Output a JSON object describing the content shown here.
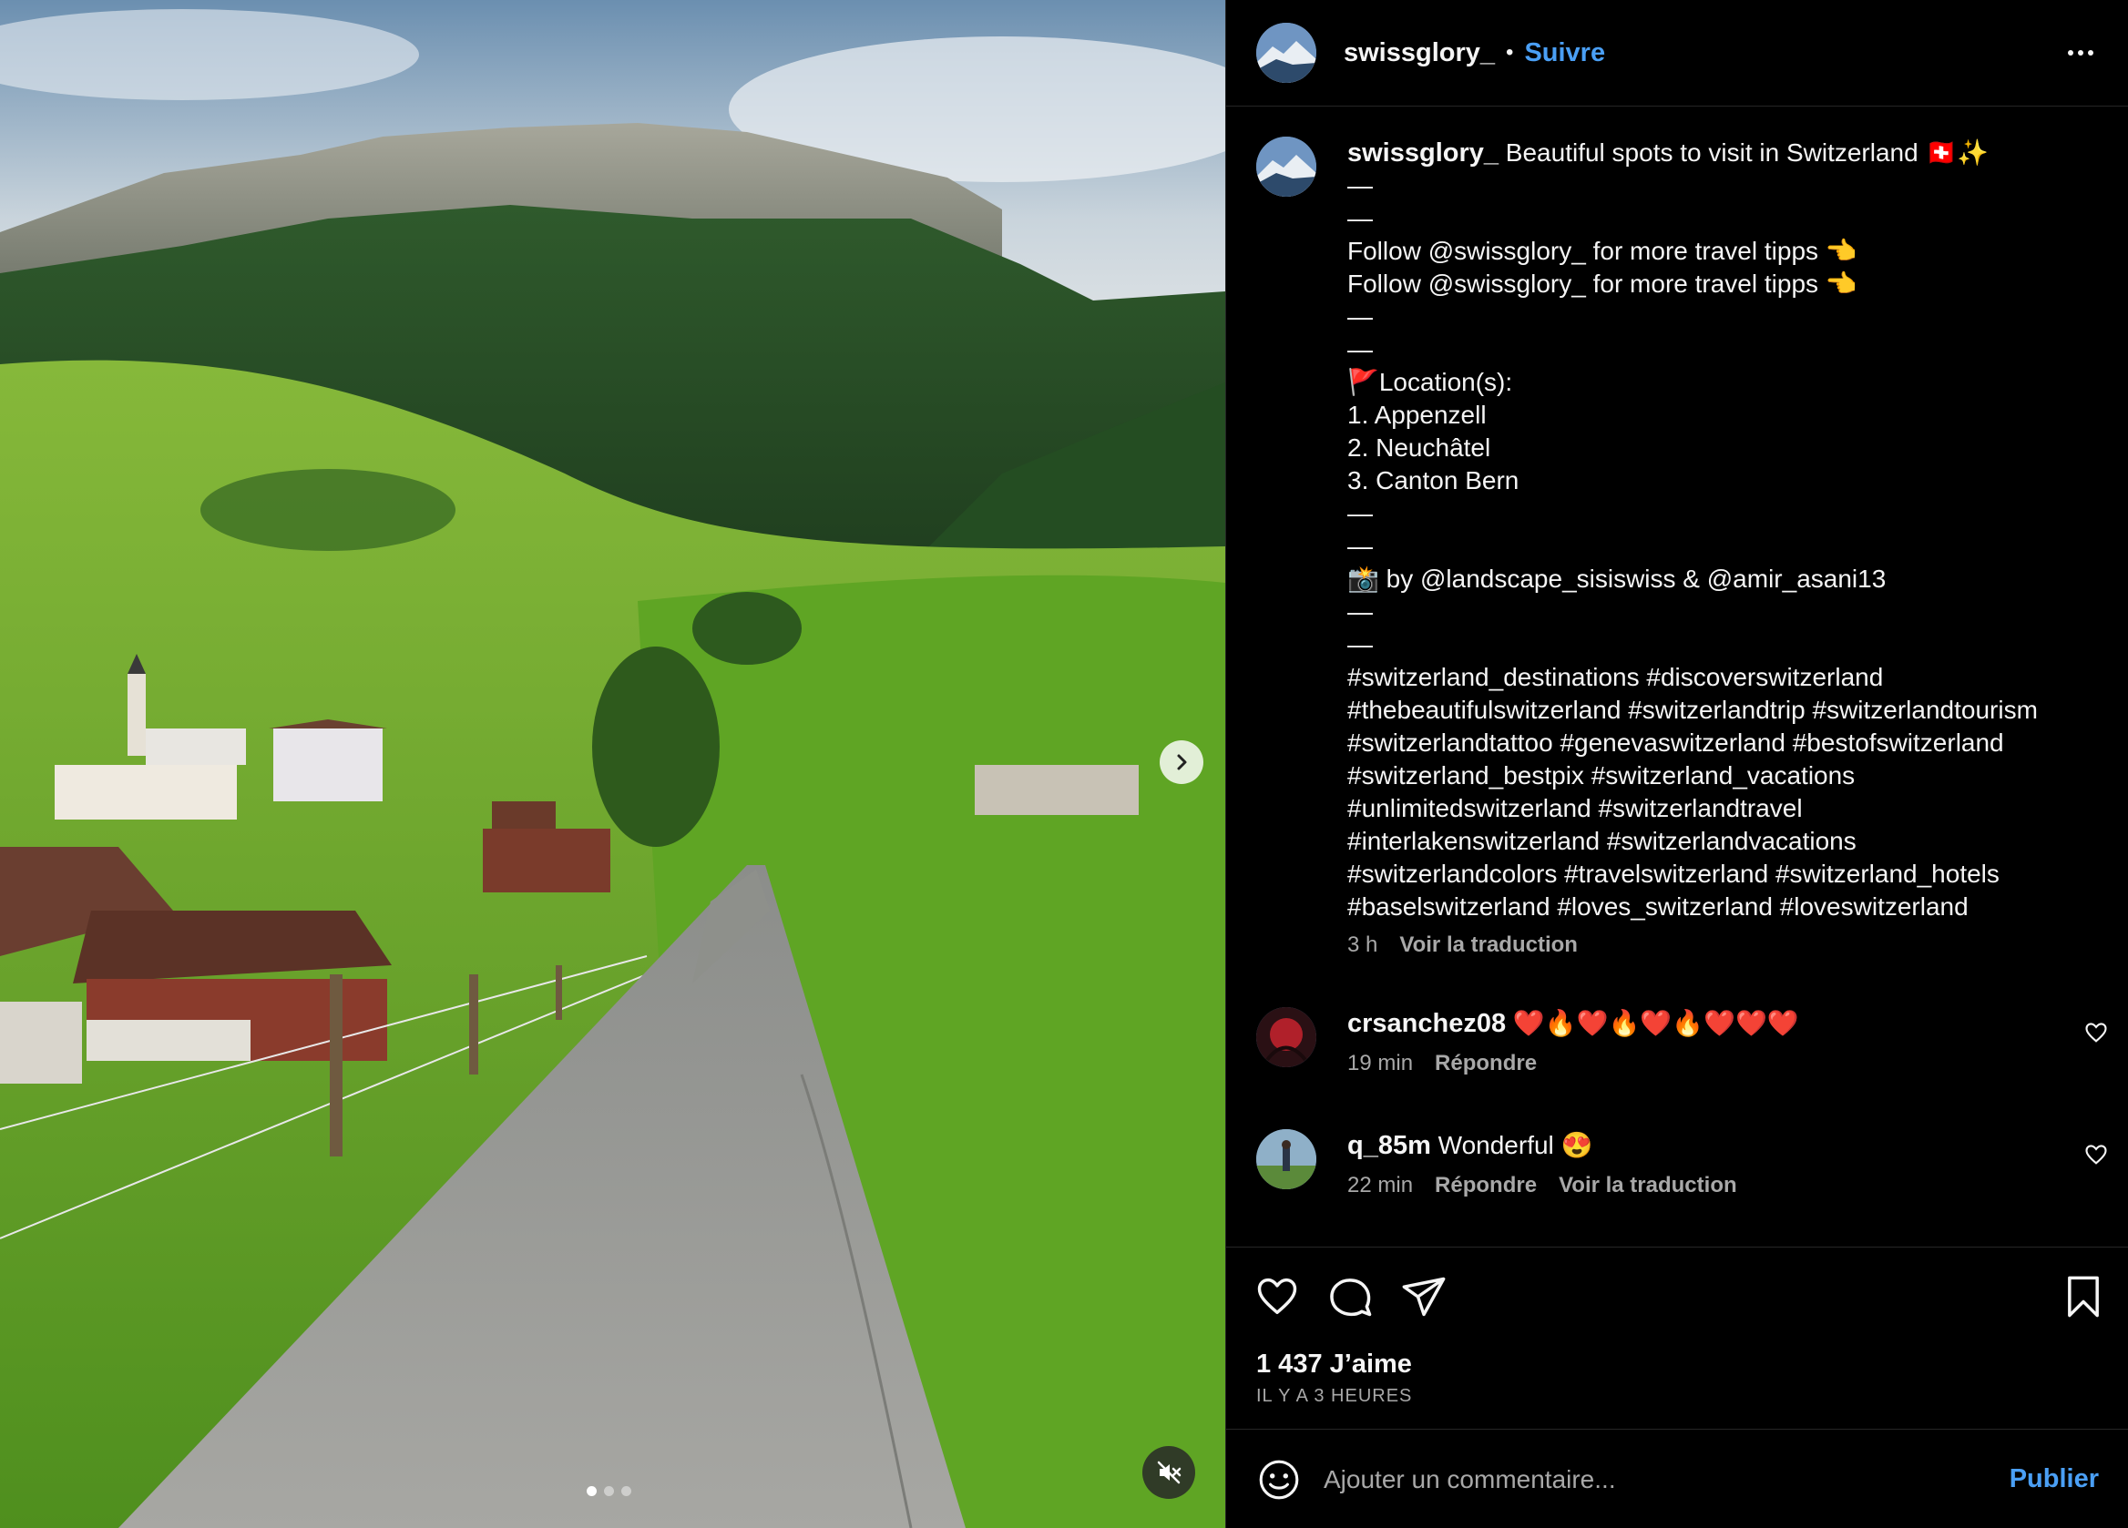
{
  "post": {
    "username": "swissglory_",
    "separator": "•",
    "follow_label": "Suivre",
    "caption_title": " Beautiful spots to visit in Switzerland 🇨🇭✨",
    "caption_body": "—\n—\nFollow @swissglory_ for more travel tipps 👈\nFollow @swissglory_ for more travel tipps 👈\n—\n—\n🚩Location(s):\n1. Appenzell\n2. Neuchâtel\n3. Canton Bern\n—\n—\n📸 by @landscape_sisiswiss & @amir_asani13\n—\n—\n#switzerland_destinations #discoverswitzerland\n#thebeautifulswitzerland #switzerlandtrip #switzerlandtourism\n#switzerlandtattoo #genevaswitzerland #bestofswitzerland\n#switzerland_bestpix #switzerland_vacations\n#unlimitedswitzerland #switzerlandtravel\n#interlakenswitzerland #switzerlandvacations\n#switzerlandcolors #travelswitzerland #switzerland_hotels\n#baselswitzerland #loves_switzerland #loveswitzerland",
    "caption_time": "3 h",
    "see_translation": "Voir la traduction"
  },
  "comments": [
    {
      "username": "crsanchez08",
      "text": " ❤️🔥❤️🔥❤️🔥❤️❤️❤️",
      "time": "19 min",
      "reply": "Répondre",
      "translate": ""
    },
    {
      "username": "q_85m",
      "text": " Wonderful 😍",
      "time": "22 min",
      "reply": "Répondre",
      "translate": "Voir la traduction"
    }
  ],
  "actions": {
    "likes": "1 437 J’aime",
    "time_ago": "IL Y A 3 HEURES"
  },
  "composer": {
    "placeholder": "Ajouter un commentaire...",
    "publish_label": "Publier"
  },
  "media": {
    "slide_count": 3,
    "active_slide": 1
  },
  "colors": {
    "accent": "#4a9ff5",
    "secondary_text": "#a8a8a8",
    "divider": "#262626"
  },
  "icons": [
    "more-icon",
    "chevron-right-icon",
    "mute-icon",
    "heart-icon",
    "comment-icon",
    "share-icon",
    "bookmark-icon",
    "emoji-icon"
  ]
}
